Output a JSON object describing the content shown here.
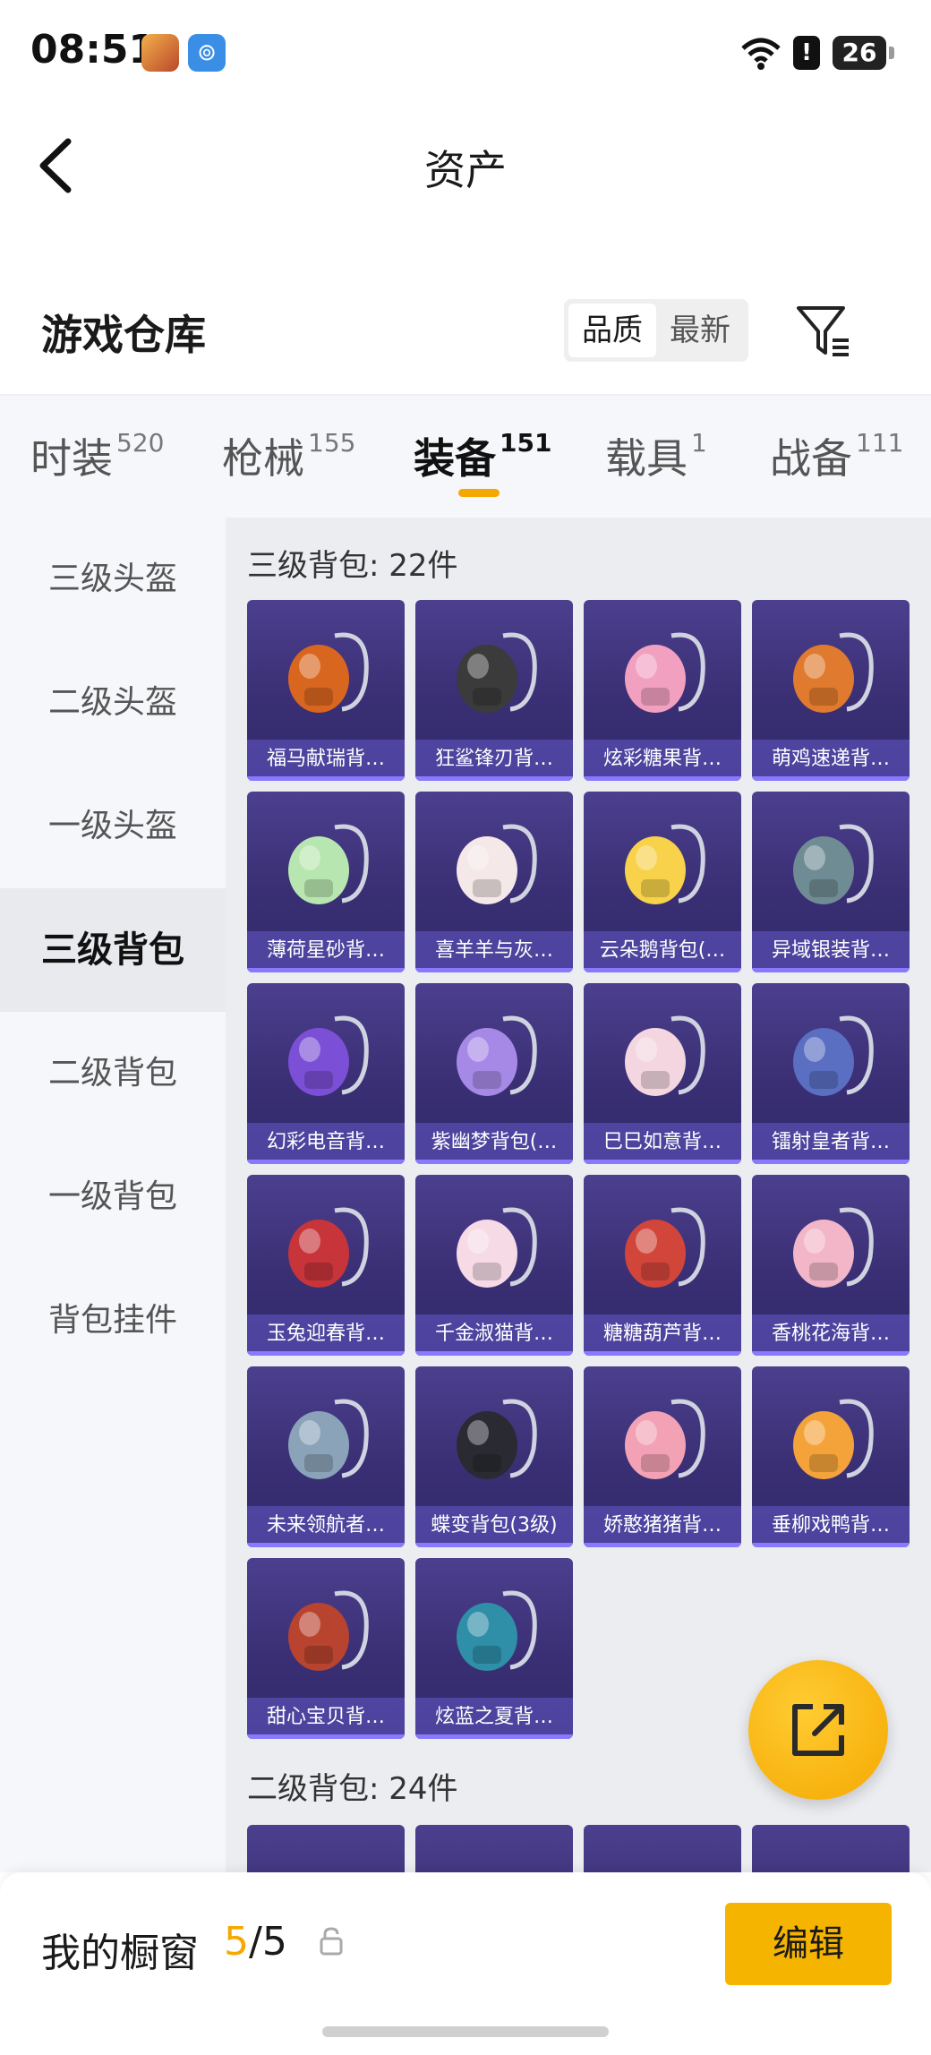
{
  "status_bar": {
    "time": "08:51",
    "battery": "26",
    "alert": "!"
  },
  "header": {
    "title": "资产"
  },
  "warehouse": {
    "title": "游戏仓库",
    "sort_options": [
      "品质",
      "最新"
    ],
    "active_sort": "品质"
  },
  "tabs": [
    {
      "label": "时装",
      "count": "520"
    },
    {
      "label": "枪械",
      "count": "155"
    },
    {
      "label": "装备",
      "count": "151"
    },
    {
      "label": "载具",
      "count": "1"
    },
    {
      "label": "战备",
      "count": "111"
    }
  ],
  "active_tab": "装备",
  "sidebar": {
    "items": [
      "三级头盔",
      "二级头盔",
      "一级头盔",
      "三级背包",
      "二级背包",
      "一级背包",
      "背包挂件"
    ],
    "active": "三级背包"
  },
  "sections": [
    {
      "title": "三级背包: 22件",
      "items": [
        {
          "name": "福马献瑞背…",
          "icon": "orange-horse-backpack",
          "color": "#d9661f"
        },
        {
          "name": "狂鲨锋刃背…",
          "icon": "shark-blade-backpack",
          "color": "#3b3b3b"
        },
        {
          "name": "炫彩糖果背…",
          "icon": "candy-donut-backpack",
          "color": "#f2a0c0"
        },
        {
          "name": "萌鸡速递背…",
          "icon": "chick-courier-backpack",
          "color": "#e07a2e"
        },
        {
          "name": "薄荷星砂背…",
          "icon": "mint-star-backpack",
          "color": "#b8e6b0"
        },
        {
          "name": "喜羊羊与灰…",
          "icon": "sheep-backpack",
          "color": "#f4e8e8"
        },
        {
          "name": "云朵鹅背包(…",
          "icon": "cloud-goose-backpack",
          "color": "#f7d24a"
        },
        {
          "name": "异域银装背…",
          "icon": "silver-armor-backpack",
          "color": "#6f8c94"
        },
        {
          "name": "幻彩电音背…",
          "icon": "electro-disc-backpack",
          "color": "#7b4fd6"
        },
        {
          "name": "紫幽梦背包(…",
          "icon": "purple-dream-backpack",
          "color": "#a689e6"
        },
        {
          "name": "巳巳如意背…",
          "icon": "snake-ruyi-backpack",
          "color": "#f3d6e0"
        },
        {
          "name": "镭射皇者背…",
          "icon": "laser-king-backpack",
          "color": "#5a6ec2"
        },
        {
          "name": "玉兔迎春背…",
          "icon": "jade-rabbit-backpack",
          "color": "#c7343a"
        },
        {
          "name": "千金淑猫背…",
          "icon": "lady-cat-backpack",
          "color": "#f6dbe6"
        },
        {
          "name": "糖糖葫芦背…",
          "icon": "candy-gourd-backpack",
          "color": "#d2453a"
        },
        {
          "name": "香桃花海背…",
          "icon": "peach-flower-backpack",
          "color": "#f2b6c8"
        },
        {
          "name": "未来领航者…",
          "icon": "future-navigator-backpack",
          "color": "#8aa3b8"
        },
        {
          "name": "蝶变背包(3级)",
          "icon": "butterfly-backpack",
          "color": "#2a2a33"
        },
        {
          "name": "娇憨猪猪背…",
          "icon": "piggy-backpack",
          "color": "#f2a2b4"
        },
        {
          "name": "垂柳戏鸭背…",
          "icon": "duck-backpack",
          "color": "#f3a33a"
        },
        {
          "name": "甜心宝贝背…",
          "icon": "sweetheart-cake-backpack",
          "color": "#b8432e"
        },
        {
          "name": "炫蓝之夏背…",
          "icon": "blue-summer-backpack",
          "color": "#2f8ea8"
        }
      ]
    },
    {
      "title": "二级背包: 24件",
      "items": []
    }
  ],
  "bottom_bar": {
    "label": "我的橱窗",
    "current": "5",
    "separator": "/",
    "max": "5",
    "edit_label": "编辑"
  }
}
